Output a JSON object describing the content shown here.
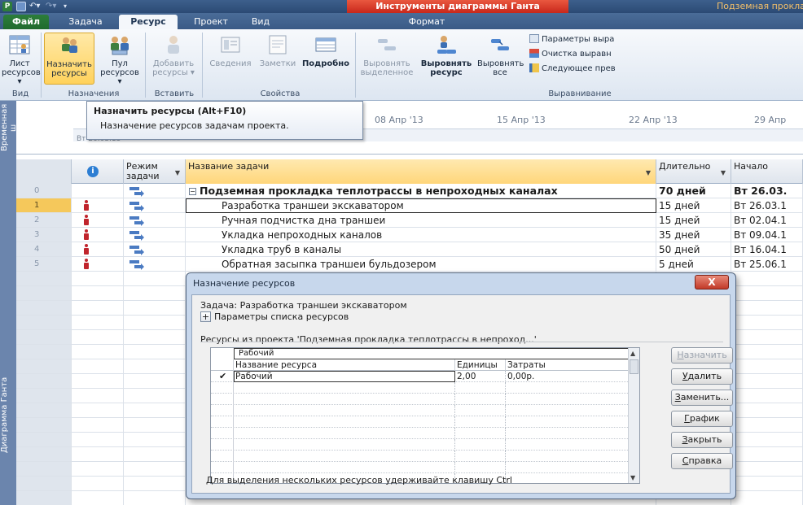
{
  "titlebar": {
    "app_letter": "P",
    "context_tools": "Инструменты диаграммы Ганта",
    "app_title": "Подземная прокла",
    "colors": {
      "context": "#d33a2a",
      "app_title": "#f3c06a"
    }
  },
  "tabs": {
    "file": "Файл",
    "task": "Задача",
    "resource": "Ресурс",
    "project": "Проект",
    "view": "Вид",
    "format": "Формат"
  },
  "ribbon": {
    "list_resources": "Лист ресурсов ▾",
    "assign_resources": "Назначить ресурсы",
    "resource_pool": "Пул ресурсов ▾",
    "add_resources": "Добавить ресурсы ▾",
    "information": "Сведения",
    "notes": "Заметки",
    "details": "Подробно",
    "level_selection": "Выровнять выделенное",
    "level_resource": "Выровнять ресурс",
    "level_all": "Выровнять все",
    "leveling_options": "Параметры выра",
    "clear_leveling": "Очистка выравн",
    "next_overallocation": "Следующее прев",
    "groups": {
      "view": "Вид",
      "assignments": "Назначения",
      "insert": "Вставить",
      "properties": "Свойства",
      "level": "Выравнивание"
    }
  },
  "tooltip": {
    "title": "Назначить ресурсы (Alt+F10)",
    "description": "Назначение ресурсов задачам проекта."
  },
  "timeline": {
    "side_label": "Временная ш",
    "start_date": "Вт 26.03.13",
    "ticks": [
      "08 Апр '13",
      "15 Апр '13",
      "22 Апр '13",
      "29 Апр"
    ]
  },
  "gantt_side_label": "Диаграмма Ганта",
  "grid": {
    "headers": {
      "mode": "Режим задачи",
      "name": "Название задачи",
      "duration": "Длительно",
      "start": "Начало"
    },
    "rows": [
      {
        "id": "0",
        "name": "Подземная прокладка теплотрассы в непроходных каналах",
        "duration": "70 дней",
        "start": "Вт 26.03."
      },
      {
        "id": "1",
        "name": "Разработка траншеи экскаватором",
        "duration": "15 дней",
        "start": "Вт 26.03.1"
      },
      {
        "id": "2",
        "name": "Ручная подчистка дна траншеи",
        "duration": "15 дней",
        "start": "Вт 02.04.1"
      },
      {
        "id": "3",
        "name": "Укладка непроходных каналов",
        "duration": "35 дней",
        "start": "Вт 09.04.1"
      },
      {
        "id": "4",
        "name": "Укладка труб в каналы",
        "duration": "50 дней",
        "start": "Вт 16.04.1"
      },
      {
        "id": "5",
        "name": "Обратная засыпка траншеи бульдозером",
        "duration": "5 дней",
        "start": "Вт 25.06.1"
      }
    ]
  },
  "dialog": {
    "title": "Назначение ресурсов",
    "close": "X",
    "task_line": "Задача: Разработка траншеи экскаватором",
    "options_toggle": "Параметры списка ресурсов",
    "resources_from": "Ресурсы из проекта 'Подземная прокладка теплотрассы в непроход...'",
    "edit_value": "Рабочий",
    "columns": {
      "name": "Название ресурса",
      "units": "Единицы",
      "cost": "Затраты"
    },
    "resources": [
      {
        "checked": "✔",
        "name": "Рабочий",
        "units": "2,00",
        "cost": "0,00р."
      }
    ],
    "buttons": {
      "assign": "Назначить",
      "remove": "Удалить",
      "replace": "Заменить...",
      "graph": "График",
      "close": "Закрыть",
      "help": "Справка"
    },
    "footer": "Для выделения нескольких ресурсов удерживайте клавишу Ctrl"
  }
}
